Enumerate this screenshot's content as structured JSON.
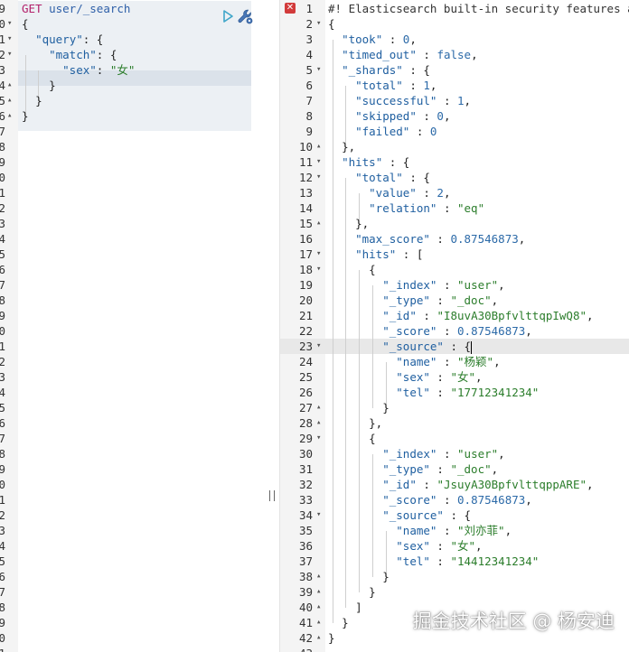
{
  "request": {
    "lines": [
      {
        "n": "9",
        "fold": "",
        "html": "<span class='kw'>GET</span> <span class='url'>user/_search</span>"
      },
      {
        "n": "0",
        "fold": "▾",
        "html": "<span class='pun'>{</span>"
      },
      {
        "n": "1",
        "fold": "▾",
        "html": "  <span class='key'>\"query\"</span><span class='pun'>: {</span>"
      },
      {
        "n": "2",
        "fold": "▾",
        "html": "    <span class='key'>\"match\"</span><span class='pun'>: {</span>"
      },
      {
        "n": "3",
        "fold": "",
        "html": "      <span class='key'>\"sex\"</span><span class='pun'>: </span><span class='str'>\"女\"</span>"
      },
      {
        "n": "4",
        "fold": "▴",
        "html": "    <span class='pun'>}</span>"
      },
      {
        "n": "5",
        "fold": "▴",
        "html": "  <span class='pun'>}</span>"
      },
      {
        "n": "6",
        "fold": "▴",
        "html": "<span class='pun'>}</span>"
      },
      {
        "n": "7",
        "fold": "",
        "html": ""
      },
      {
        "n": "8",
        "fold": "",
        "html": ""
      },
      {
        "n": "9",
        "fold": "",
        "html": ""
      },
      {
        "n": "0",
        "fold": "",
        "html": ""
      },
      {
        "n": "1",
        "fold": "",
        "html": ""
      },
      {
        "n": "2",
        "fold": "",
        "html": ""
      },
      {
        "n": "3",
        "fold": "",
        "html": ""
      },
      {
        "n": "4",
        "fold": "",
        "html": ""
      },
      {
        "n": "5",
        "fold": "",
        "html": ""
      },
      {
        "n": "6",
        "fold": "",
        "html": ""
      },
      {
        "n": "7",
        "fold": "",
        "html": ""
      },
      {
        "n": "8",
        "fold": "",
        "html": ""
      },
      {
        "n": "9",
        "fold": "",
        "html": ""
      },
      {
        "n": "0",
        "fold": "",
        "html": ""
      },
      {
        "n": "1",
        "fold": "",
        "html": ""
      },
      {
        "n": "2",
        "fold": "",
        "html": ""
      },
      {
        "n": "3",
        "fold": "",
        "html": ""
      },
      {
        "n": "4",
        "fold": "",
        "html": ""
      },
      {
        "n": "5",
        "fold": "",
        "html": ""
      },
      {
        "n": "6",
        "fold": "",
        "html": ""
      },
      {
        "n": "7",
        "fold": "",
        "html": ""
      },
      {
        "n": "8",
        "fold": "",
        "html": ""
      },
      {
        "n": "9",
        "fold": "",
        "html": ""
      },
      {
        "n": "0",
        "fold": "",
        "html": ""
      },
      {
        "n": "1",
        "fold": "",
        "html": ""
      },
      {
        "n": "2",
        "fold": "",
        "html": ""
      },
      {
        "n": "3",
        "fold": "",
        "html": ""
      },
      {
        "n": "4",
        "fold": "",
        "html": ""
      },
      {
        "n": "5",
        "fold": "",
        "html": ""
      },
      {
        "n": "6",
        "fold": "",
        "html": ""
      },
      {
        "n": "7",
        "fold": "",
        "html": ""
      },
      {
        "n": "8",
        "fold": "",
        "html": ""
      },
      {
        "n": "9",
        "fold": "",
        "html": ""
      },
      {
        "n": "0",
        "fold": "",
        "html": ""
      },
      {
        "n": "1",
        "fold": "",
        "html": ""
      }
    ]
  },
  "response": {
    "lines": [
      {
        "n": "1",
        "fold": "",
        "html": "<span class='cmt'>#! Elasticsearch built-in security features are not enabled</span>"
      },
      {
        "n": "2",
        "fold": "▾",
        "html": "<span class='pun'>{</span>"
      },
      {
        "n": "3",
        "fold": "",
        "html": "  <span class='key'>\"took\"</span><span class='pun'> : </span><span class='num'>0</span><span class='pun'>,</span>"
      },
      {
        "n": "4",
        "fold": "",
        "html": "  <span class='key'>\"timed_out\"</span><span class='pun'> : </span><span class='num'>false</span><span class='pun'>,</span>"
      },
      {
        "n": "5",
        "fold": "▾",
        "html": "  <span class='key'>\"_shards\"</span><span class='pun'> : {</span>"
      },
      {
        "n": "6",
        "fold": "",
        "html": "    <span class='key'>\"total\"</span><span class='pun'> : </span><span class='num'>1</span><span class='pun'>,</span>"
      },
      {
        "n": "7",
        "fold": "",
        "html": "    <span class='key'>\"successful\"</span><span class='pun'> : </span><span class='num'>1</span><span class='pun'>,</span>"
      },
      {
        "n": "8",
        "fold": "",
        "html": "    <span class='key'>\"skipped\"</span><span class='pun'> : </span><span class='num'>0</span><span class='pun'>,</span>"
      },
      {
        "n": "9",
        "fold": "",
        "html": "    <span class='key'>\"failed\"</span><span class='pun'> : </span><span class='num'>0</span>"
      },
      {
        "n": "10",
        "fold": "▴",
        "html": "  <span class='pun'>},</span>"
      },
      {
        "n": "11",
        "fold": "▾",
        "html": "  <span class='key'>\"hits\"</span><span class='pun'> : {</span>"
      },
      {
        "n": "12",
        "fold": "▾",
        "html": "    <span class='key'>\"total\"</span><span class='pun'> : {</span>"
      },
      {
        "n": "13",
        "fold": "",
        "html": "      <span class='key'>\"value\"</span><span class='pun'> : </span><span class='num'>2</span><span class='pun'>,</span>"
      },
      {
        "n": "14",
        "fold": "",
        "html": "      <span class='key'>\"relation\"</span><span class='pun'> : </span><span class='str'>\"eq\"</span>"
      },
      {
        "n": "15",
        "fold": "▴",
        "html": "    <span class='pun'>},</span>"
      },
      {
        "n": "16",
        "fold": "",
        "html": "    <span class='key'>\"max_score\"</span><span class='pun'> : </span><span class='num'>0.87546873</span><span class='pun'>,</span>"
      },
      {
        "n": "17",
        "fold": "▾",
        "html": "    <span class='key'>\"hits\"</span><span class='pun'> : [</span>"
      },
      {
        "n": "18",
        "fold": "▾",
        "html": "      <span class='pun'>{</span>"
      },
      {
        "n": "19",
        "fold": "",
        "html": "        <span class='key'>\"_index\"</span><span class='pun'> : </span><span class='str'>\"user\"</span><span class='pun'>,</span>"
      },
      {
        "n": "20",
        "fold": "",
        "html": "        <span class='key'>\"_type\"</span><span class='pun'> : </span><span class='str'>\"_doc\"</span><span class='pun'>,</span>"
      },
      {
        "n": "21",
        "fold": "",
        "html": "        <span class='key'>\"_id\"</span><span class='pun'> : </span><span class='str'>\"I8uvA30BpfvlttqpIwQ8\"</span><span class='pun'>,</span>"
      },
      {
        "n": "22",
        "fold": "",
        "html": "        <span class='key'>\"_score\"</span><span class='pun'> : </span><span class='num'>0.87546873</span><span class='pun'>,</span>"
      },
      {
        "n": "23",
        "fold": "▾",
        "html": "        <span class='key'>\"_source\"</span><span class='pun'> : {</span><span class='cursor'></span>"
      },
      {
        "n": "24",
        "fold": "",
        "html": "          <span class='key'>\"name\"</span><span class='pun'> : </span><span class='str'>\"杨颖\"</span><span class='pun'>,</span>"
      },
      {
        "n": "25",
        "fold": "",
        "html": "          <span class='key'>\"sex\"</span><span class='pun'> : </span><span class='str'>\"女\"</span><span class='pun'>,</span>"
      },
      {
        "n": "26",
        "fold": "",
        "html": "          <span class='key'>\"tel\"</span><span class='pun'> : </span><span class='str'>\"17712341234\"</span>"
      },
      {
        "n": "27",
        "fold": "▴",
        "html": "        <span class='pun'>}</span>"
      },
      {
        "n": "28",
        "fold": "▴",
        "html": "      <span class='pun'>},</span>"
      },
      {
        "n": "29",
        "fold": "▾",
        "html": "      <span class='pun'>{</span>"
      },
      {
        "n": "30",
        "fold": "",
        "html": "        <span class='key'>\"_index\"</span><span class='pun'> : </span><span class='str'>\"user\"</span><span class='pun'>,</span>"
      },
      {
        "n": "31",
        "fold": "",
        "html": "        <span class='key'>\"_type\"</span><span class='pun'> : </span><span class='str'>\"_doc\"</span><span class='pun'>,</span>"
      },
      {
        "n": "32",
        "fold": "",
        "html": "        <span class='key'>\"_id\"</span><span class='pun'> : </span><span class='str'>\"JsuyA30BpfvlttqppARE\"</span><span class='pun'>,</span>"
      },
      {
        "n": "33",
        "fold": "",
        "html": "        <span class='key'>\"_score\"</span><span class='pun'> : </span><span class='num'>0.87546873</span><span class='pun'>,</span>"
      },
      {
        "n": "34",
        "fold": "▾",
        "html": "        <span class='key'>\"_source\"</span><span class='pun'> : {</span>"
      },
      {
        "n": "35",
        "fold": "",
        "html": "          <span class='key'>\"name\"</span><span class='pun'> : </span><span class='str'>\"刘亦菲\"</span><span class='pun'>,</span>"
      },
      {
        "n": "36",
        "fold": "",
        "html": "          <span class='key'>\"sex\"</span><span class='pun'> : </span><span class='str'>\"女\"</span><span class='pun'>,</span>"
      },
      {
        "n": "37",
        "fold": "",
        "html": "          <span class='key'>\"tel\"</span><span class='pun'> : </span><span class='str'>\"14412341234\"</span>"
      },
      {
        "n": "38",
        "fold": "▴",
        "html": "        <span class='pun'>}</span>"
      },
      {
        "n": "39",
        "fold": "▴",
        "html": "      <span class='pun'>}</span>"
      },
      {
        "n": "40",
        "fold": "▴",
        "html": "    <span class='pun'>]</span>"
      },
      {
        "n": "41",
        "fold": "▴",
        "html": "  <span class='pun'>}</span>"
      },
      {
        "n": "42",
        "fold": "▴",
        "html": "<span class='pun'>}</span>"
      },
      {
        "n": "43",
        "fold": "",
        "html": ""
      }
    ]
  },
  "watermark": "掘金技术社区 @ 杨安迪",
  "colors": {
    "keyword": "#b3206a",
    "string": "#2b7d2b",
    "key": "#1f5fa0",
    "error": "#d23b3b",
    "play": "#3fa6c9"
  }
}
